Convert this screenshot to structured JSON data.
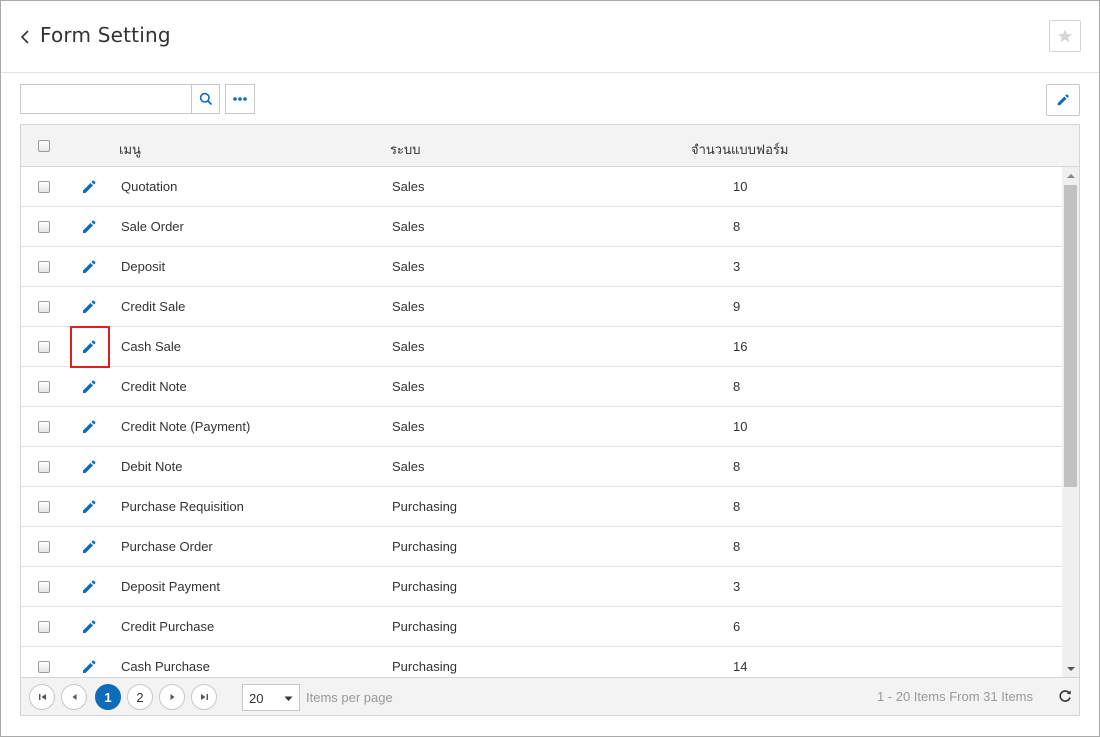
{
  "header": {
    "title": "Form Setting",
    "back_icon": "chevron-left-icon",
    "favorite_icon": "star-icon"
  },
  "toolbar": {
    "search_value": "",
    "search_placeholder": "",
    "search_icon": "search-icon",
    "more_icon": "ellipsis-icon",
    "edit_icon": "pencil-icon"
  },
  "grid": {
    "columns": [
      "เมนู",
      "ระบบ",
      "จำนวนแบบฟอร์ม"
    ],
    "rows": [
      {
        "menu": "Quotation",
        "system": "Sales",
        "count": "10"
      },
      {
        "menu": "Sale Order",
        "system": "Sales",
        "count": "8"
      },
      {
        "menu": "Deposit",
        "system": "Sales",
        "count": "3"
      },
      {
        "menu": "Credit Sale",
        "system": "Sales",
        "count": "9"
      },
      {
        "menu": "Cash Sale",
        "system": "Sales",
        "count": "16"
      },
      {
        "menu": "Credit Note",
        "system": "Sales",
        "count": "8"
      },
      {
        "menu": "Credit Note (Payment)",
        "system": "Sales",
        "count": "10"
      },
      {
        "menu": "Debit Note",
        "system": "Sales",
        "count": "8"
      },
      {
        "menu": "Purchase Requisition",
        "system": "Purchasing",
        "count": "8"
      },
      {
        "menu": "Purchase Order",
        "system": "Purchasing",
        "count": "8"
      },
      {
        "menu": "Deposit Payment",
        "system": "Purchasing",
        "count": "3"
      },
      {
        "menu": "Credit Purchase",
        "system": "Purchasing",
        "count": "6"
      },
      {
        "menu": "Cash Purchase",
        "system": "Purchasing",
        "count": "14"
      }
    ],
    "highlighted_row": 4
  },
  "pager": {
    "pages": [
      "1",
      "2"
    ],
    "current_page": "1",
    "page_size": "20",
    "items_per_page_label": "Items per page",
    "info": "1 - 20 Items From 31 Items"
  },
  "colors": {
    "accent": "#0d6cb8",
    "highlight": "#e0201f"
  }
}
